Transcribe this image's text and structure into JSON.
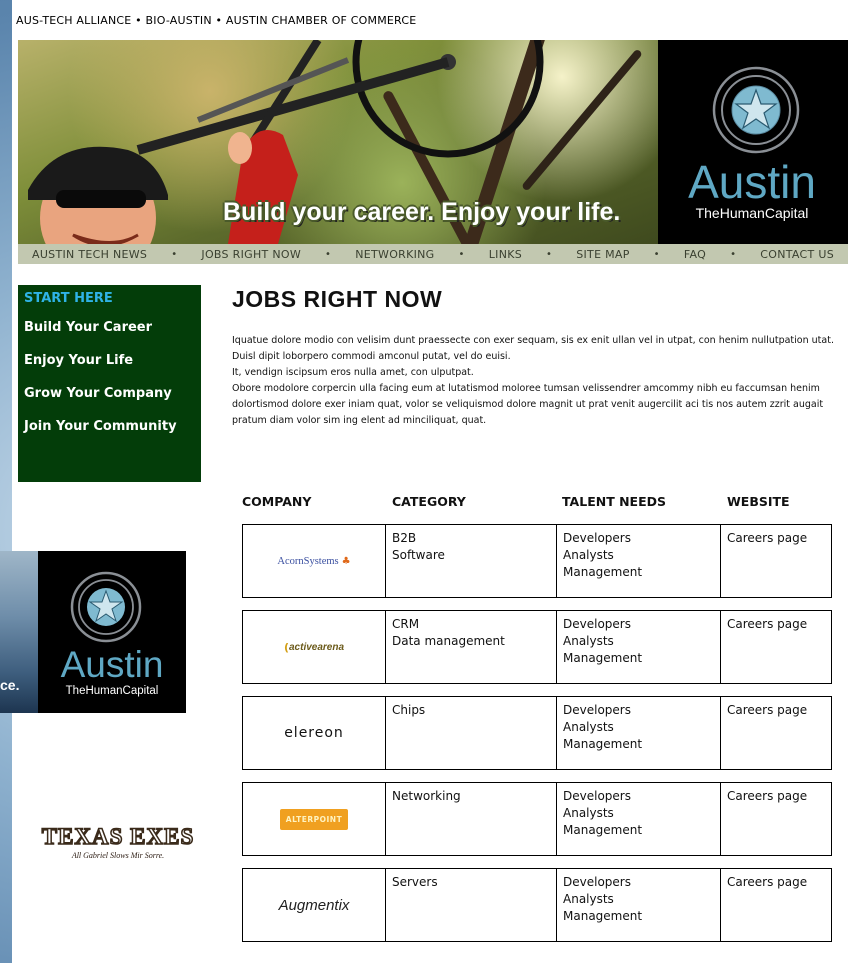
{
  "header": {
    "associations": "AUS-TECH ALLIANCE • BIO-AUSTIN • AUSTIN CHAMBER OF COMMERCE",
    "tagline": "Build your career. Enjoy your life.",
    "logo_title": "Austin",
    "logo_subtitle": "TheHumanCapital"
  },
  "nav": {
    "items": [
      "AUSTIN TECH NEWS",
      "JOBS RIGHT NOW",
      "NETWORKING",
      "LINKS",
      "SITE MAP",
      "FAQ",
      "CONTACT US"
    ],
    "separator": "•"
  },
  "sidebar": {
    "heading": "START HERE",
    "items": [
      "Build Your Career",
      "Enjoy Your Life",
      "Grow Your Company",
      "Join Your Community"
    ]
  },
  "main": {
    "title": "JOBS RIGHT NOW",
    "paragraphs": [
      "Iquatue dolore modio con velisim dunt praessecte con exer sequam, sis ex enit ullan vel in utpat, con henim nullutpation utat. Duisl dipit loborpero commodi amconul putat, vel do euisi.",
      "It, vendign iscipsum eros nulla amet, con ulputpat.",
      "Obore modolore corpercin ulla facing eum at lutatismod moloree tumsan velissendrer amcommy nibh eu faccumsan henim dolortismod dolore exer iniam quat, volor se veliquismod dolore magnit ut prat venit augercilit aci tis nos autem zzrit augait pratum diam volor sim ing elent ad minciliquat, quat."
    ]
  },
  "table": {
    "headers": [
      "COMPANY",
      "CATEGORY",
      "TALENT NEEDS",
      "WEBSITE"
    ],
    "rows": [
      {
        "company": "AcornSystems",
        "category": "B2B\nSoftware",
        "talent": "Developers\nAnalysts\nManagement",
        "website": "Careers page"
      },
      {
        "company": "activearena",
        "category": "CRM\nData management",
        "talent": "Developers\nAnalysts\nManagement",
        "website": "Careers page"
      },
      {
        "company": "elereon",
        "category": "Chips",
        "talent": "Developers\nAnalysts\nManagement",
        "website": "Careers page"
      },
      {
        "company": "ALTERPOINT",
        "category": "Networking",
        "talent": "Developers\nAnalysts\nManagement",
        "website": "Careers page"
      },
      {
        "company": "Augmentix",
        "category": "Servers",
        "talent": "Developers\nAnalysts\nManagement",
        "website": "Careers page"
      }
    ]
  },
  "promo": {
    "fragment": "ce.",
    "logo_title": "Austin",
    "logo_subtitle": "TheHumanCapital"
  },
  "texas_exes": {
    "title": "TEXAS EXES",
    "subtitle": "All Gabriel Slows Mir Sorre."
  },
  "colors": {
    "sidebar_bg": "#033d09",
    "sidebar_heading": "#2fb3e6",
    "navbar_bg": "#c2c8b0",
    "logo_accent": "#5fa8c4"
  }
}
